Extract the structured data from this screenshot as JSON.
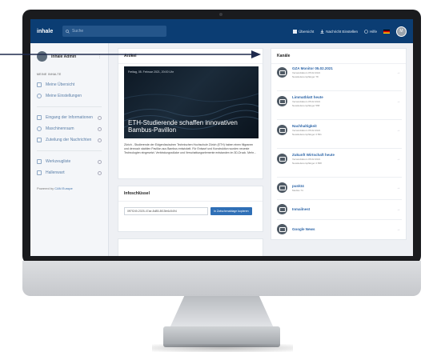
{
  "app": {
    "logo_text": "inhale",
    "search_placeholder": "Suche",
    "nav": {
      "overview": "Übersicht",
      "settings": "Nachricht Einstellen",
      "help": "Hilfe",
      "avatar_initial": "M"
    }
  },
  "sidebar": {
    "user_name": "Inhale Admin",
    "section_label": "MEINE INHALTE",
    "items_top": [
      {
        "label": "Meine Übersicht"
      },
      {
        "label": "Meine Einstellungen"
      }
    ],
    "items_mid": [
      {
        "label": "Eingang der Informationen"
      },
      {
        "label": "Maschinenraum"
      },
      {
        "label": "Zuteilung der Nachrichten"
      }
    ],
    "items_bottom": [
      {
        "label": "Werkzeugliste"
      },
      {
        "label": "Hallenwart"
      }
    ],
    "footer_prefix": "Powered by",
    "footer_link": "CAN Europe"
  },
  "article": {
    "card_title": "Artikel",
    "date": "Freitag, 05. Februar 2021, 20:00 Uhr",
    "headline": "ETH-Studierende schaffen innovativen Bambus-Pavillon",
    "text": "Zürich - Studierende der Eidgenössischen Technischen Hochschule Zürich (ETH) haben einen filigranen und dennoch stabilen Pavillon aus Bambus entwickelt. Für Entwurf und Konstruktion wurden neueste Technologien eingesetzt. Verbindungsstücke und Verschattungselemente entstanden im 3D-Druck. Mehr..."
  },
  "info": {
    "card_title": "Infoschlüssel",
    "uid": "0ff7f249-2025-47ae-8d85-8f13fe6c5494",
    "copy_label": "In Zwischenablage kopieren"
  },
  "channels": {
    "card_title": "Kanäle",
    "items": [
      {
        "name": "GZA Monitor 05.02.2021",
        "meta1": "Versanddatum 05.02.2021",
        "meta2": "Newsletterempfänger 78"
      },
      {
        "name": "Limmatblatt heute",
        "meta1": "Versanddatum 05.02.2021",
        "meta2": "Newsletterempfänger 558"
      },
      {
        "name": "Nachhaltigkeit",
        "meta1": "Versanddatum 05.02.2021",
        "meta2": "Newsletterempfänger 2.561"
      },
      {
        "name": "Zukunft Wirtschaft heute",
        "meta1": "Versanddatum 05.02.2021",
        "meta2": "Newsletterempfänger 2.568"
      },
      {
        "name": "punkt4",
        "meta1": "Mediss 74",
        "meta2": ""
      },
      {
        "name": "Inmailnest",
        "meta1": "",
        "meta2": ""
      },
      {
        "name": "Google News",
        "meta1": "",
        "meta2": ""
      }
    ]
  }
}
